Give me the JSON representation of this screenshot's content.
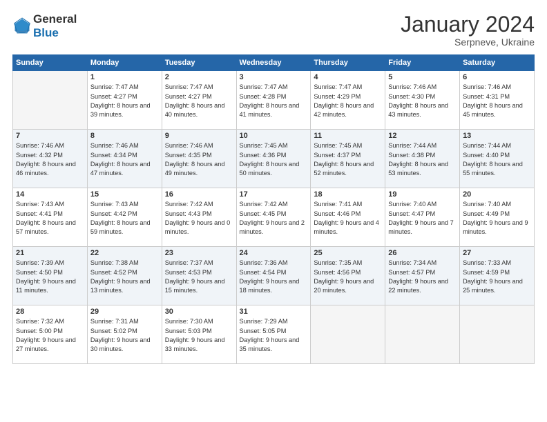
{
  "header": {
    "logo_general": "General",
    "logo_blue": "Blue",
    "month": "January 2024",
    "location": "Serpneve, Ukraine"
  },
  "days_of_week": [
    "Sunday",
    "Monday",
    "Tuesday",
    "Wednesday",
    "Thursday",
    "Friday",
    "Saturday"
  ],
  "weeks": [
    [
      {
        "day": "",
        "sunrise": "",
        "sunset": "",
        "daylight": ""
      },
      {
        "day": "1",
        "sunrise": "7:47 AM",
        "sunset": "4:27 PM",
        "daylight": "8 hours and 39 minutes."
      },
      {
        "day": "2",
        "sunrise": "7:47 AM",
        "sunset": "4:27 PM",
        "daylight": "8 hours and 40 minutes."
      },
      {
        "day": "3",
        "sunrise": "7:47 AM",
        "sunset": "4:28 PM",
        "daylight": "8 hours and 41 minutes."
      },
      {
        "day": "4",
        "sunrise": "7:47 AM",
        "sunset": "4:29 PM",
        "daylight": "8 hours and 42 minutes."
      },
      {
        "day": "5",
        "sunrise": "7:46 AM",
        "sunset": "4:30 PM",
        "daylight": "8 hours and 43 minutes."
      },
      {
        "day": "6",
        "sunrise": "7:46 AM",
        "sunset": "4:31 PM",
        "daylight": "8 hours and 45 minutes."
      }
    ],
    [
      {
        "day": "7",
        "sunrise": "7:46 AM",
        "sunset": "4:32 PM",
        "daylight": "8 hours and 46 minutes."
      },
      {
        "day": "8",
        "sunrise": "7:46 AM",
        "sunset": "4:34 PM",
        "daylight": "8 hours and 47 minutes."
      },
      {
        "day": "9",
        "sunrise": "7:46 AM",
        "sunset": "4:35 PM",
        "daylight": "8 hours and 49 minutes."
      },
      {
        "day": "10",
        "sunrise": "7:45 AM",
        "sunset": "4:36 PM",
        "daylight": "8 hours and 50 minutes."
      },
      {
        "day": "11",
        "sunrise": "7:45 AM",
        "sunset": "4:37 PM",
        "daylight": "8 hours and 52 minutes."
      },
      {
        "day": "12",
        "sunrise": "7:44 AM",
        "sunset": "4:38 PM",
        "daylight": "8 hours and 53 minutes."
      },
      {
        "day": "13",
        "sunrise": "7:44 AM",
        "sunset": "4:40 PM",
        "daylight": "8 hours and 55 minutes."
      }
    ],
    [
      {
        "day": "14",
        "sunrise": "7:43 AM",
        "sunset": "4:41 PM",
        "daylight": "8 hours and 57 minutes."
      },
      {
        "day": "15",
        "sunrise": "7:43 AM",
        "sunset": "4:42 PM",
        "daylight": "8 hours and 59 minutes."
      },
      {
        "day": "16",
        "sunrise": "7:42 AM",
        "sunset": "4:43 PM",
        "daylight": "9 hours and 0 minutes."
      },
      {
        "day": "17",
        "sunrise": "7:42 AM",
        "sunset": "4:45 PM",
        "daylight": "9 hours and 2 minutes."
      },
      {
        "day": "18",
        "sunrise": "7:41 AM",
        "sunset": "4:46 PM",
        "daylight": "9 hours and 4 minutes."
      },
      {
        "day": "19",
        "sunrise": "7:40 AM",
        "sunset": "4:47 PM",
        "daylight": "9 hours and 7 minutes."
      },
      {
        "day": "20",
        "sunrise": "7:40 AM",
        "sunset": "4:49 PM",
        "daylight": "9 hours and 9 minutes."
      }
    ],
    [
      {
        "day": "21",
        "sunrise": "7:39 AM",
        "sunset": "4:50 PM",
        "daylight": "9 hours and 11 minutes."
      },
      {
        "day": "22",
        "sunrise": "7:38 AM",
        "sunset": "4:52 PM",
        "daylight": "9 hours and 13 minutes."
      },
      {
        "day": "23",
        "sunrise": "7:37 AM",
        "sunset": "4:53 PM",
        "daylight": "9 hours and 15 minutes."
      },
      {
        "day": "24",
        "sunrise": "7:36 AM",
        "sunset": "4:54 PM",
        "daylight": "9 hours and 18 minutes."
      },
      {
        "day": "25",
        "sunrise": "7:35 AM",
        "sunset": "4:56 PM",
        "daylight": "9 hours and 20 minutes."
      },
      {
        "day": "26",
        "sunrise": "7:34 AM",
        "sunset": "4:57 PM",
        "daylight": "9 hours and 22 minutes."
      },
      {
        "day": "27",
        "sunrise": "7:33 AM",
        "sunset": "4:59 PM",
        "daylight": "9 hours and 25 minutes."
      }
    ],
    [
      {
        "day": "28",
        "sunrise": "7:32 AM",
        "sunset": "5:00 PM",
        "daylight": "9 hours and 27 minutes."
      },
      {
        "day": "29",
        "sunrise": "7:31 AM",
        "sunset": "5:02 PM",
        "daylight": "9 hours and 30 minutes."
      },
      {
        "day": "30",
        "sunrise": "7:30 AM",
        "sunset": "5:03 PM",
        "daylight": "9 hours and 33 minutes."
      },
      {
        "day": "31",
        "sunrise": "7:29 AM",
        "sunset": "5:05 PM",
        "daylight": "9 hours and 35 minutes."
      },
      {
        "day": "",
        "sunrise": "",
        "sunset": "",
        "daylight": ""
      },
      {
        "day": "",
        "sunrise": "",
        "sunset": "",
        "daylight": ""
      },
      {
        "day": "",
        "sunrise": "",
        "sunset": "",
        "daylight": ""
      }
    ]
  ]
}
